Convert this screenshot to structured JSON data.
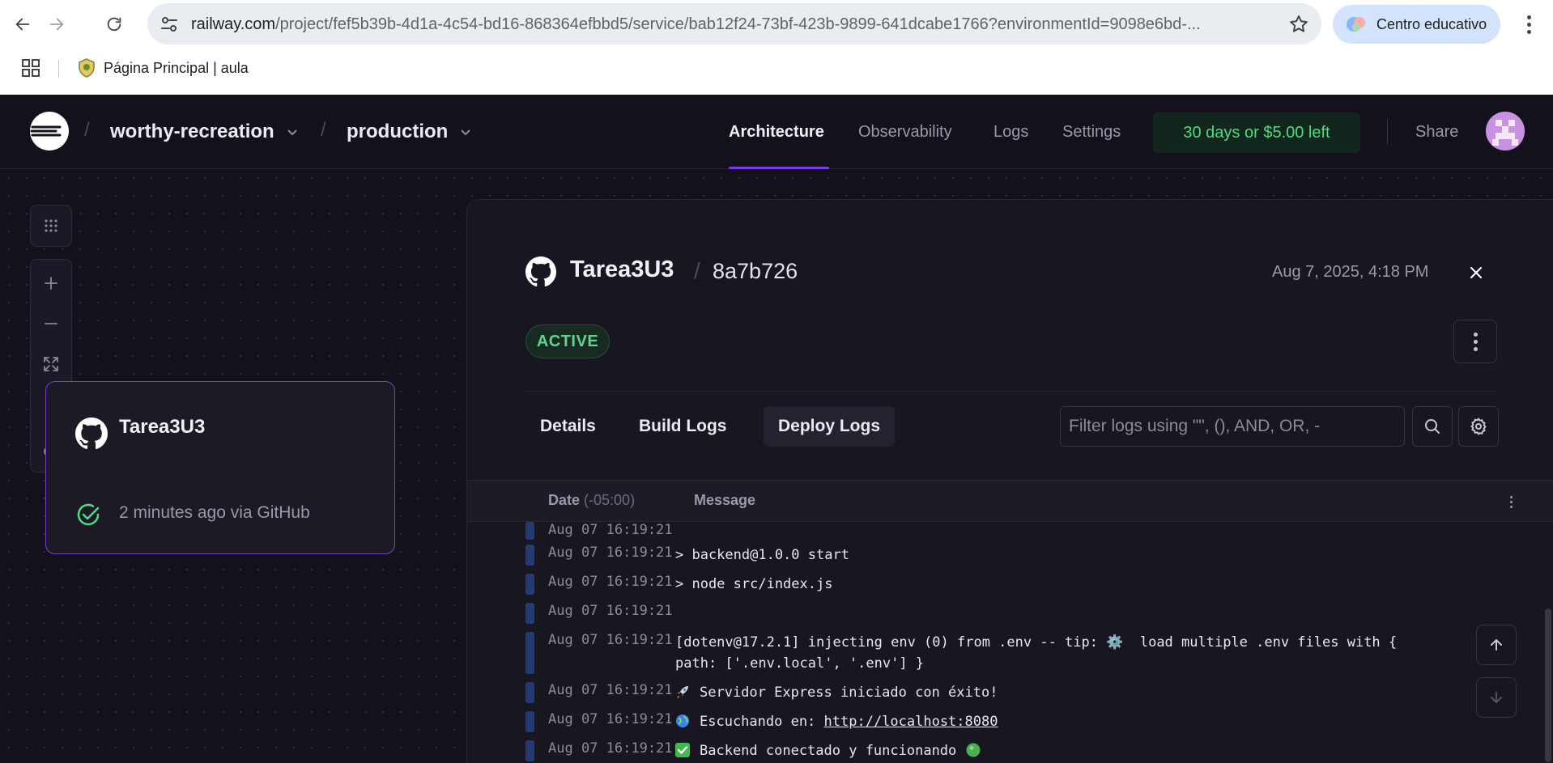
{
  "browser": {
    "url_host": "railway.com",
    "url_path": "/project/fef5b39b-4d1a-4c54-bd16-868364efbbd5/service/bab12f24-73bf-423b-9899-641dcabe1766?environmentId=9098e6bd-...",
    "profile_label": "Centro educativo",
    "bookmark_label": "Página Principal | aula",
    "icons": [
      "back-icon",
      "forward-icon",
      "reload-icon",
      "site-settings-icon",
      "star-icon",
      "apps-icon",
      "kebab-icon"
    ]
  },
  "topbar": {
    "project_name": "worthy-recreation",
    "environment_name": "production",
    "tabs": [
      {
        "label": "Architecture",
        "active": true
      },
      {
        "label": "Observability",
        "active": false
      },
      {
        "label": "Logs",
        "active": false
      },
      {
        "label": "Settings",
        "active": false
      }
    ],
    "trial_badge": "30 days or $5.00 left",
    "share_label": "Share"
  },
  "service_card": {
    "name": "Tarea3U3",
    "status": "2 minutes ago via GitHub"
  },
  "panel": {
    "repo": "Tarea3U3",
    "separator": "/",
    "commit": "8a7b726",
    "date": "Aug 7, 2025, 4:18 PM",
    "status": "ACTIVE",
    "tabs": [
      {
        "label": "Details",
        "active": false
      },
      {
        "label": "Build Logs",
        "active": false
      },
      {
        "label": "Deploy Logs",
        "active": true
      }
    ],
    "filter_placeholder": "Filter logs using \"\", (), AND, OR, -",
    "columns": {
      "date": "Date",
      "timezone": "(-05:00)",
      "message": "Message"
    }
  },
  "logs": [
    {
      "date": "Aug 07 16:19:21",
      "message": ""
    },
    {
      "date": "Aug 07 16:19:21",
      "message": "> backend@1.0.0 start"
    },
    {
      "date": "Aug 07 16:19:21",
      "message": "> node src/index.js"
    },
    {
      "date": "Aug 07 16:19:21",
      "message": ""
    },
    {
      "date": "Aug 07 16:19:21",
      "message": "[dotenv@17.2.1] injecting env (0) from .env -- tip: ⚙️  load multiple .env files with { path: ['.env.local', '.env'] }"
    },
    {
      "date": "Aug 07 16:19:21",
      "message": "Servidor Express iniciado con éxito!",
      "emoji": "rocket"
    },
    {
      "date": "Aug 07 16:19:21",
      "message_prefix": "Escuchando en: ",
      "link": "http://localhost:8080",
      "emoji": "globe"
    },
    {
      "date": "Aug 07 16:19:21",
      "message": "Backend conectado y funcionando",
      "emoji": "check",
      "trailing": "green-circle"
    }
  ],
  "colors": {
    "app_bg": "#13111c",
    "panel_bg": "#181620",
    "accent": "#7c3aed",
    "success": "#4ade80",
    "log_bar": "#233a73"
  }
}
